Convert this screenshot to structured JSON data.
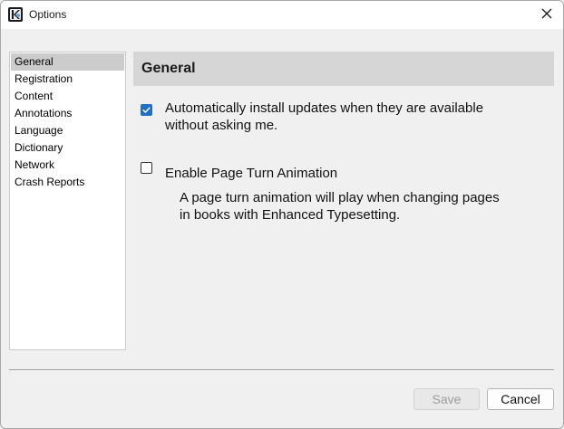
{
  "window": {
    "title": "Options",
    "icon": "kindle-reader-icon"
  },
  "sidebar": {
    "selected_index": 0,
    "items": [
      {
        "label": "General"
      },
      {
        "label": "Registration"
      },
      {
        "label": "Content"
      },
      {
        "label": "Annotations"
      },
      {
        "label": "Language"
      },
      {
        "label": "Dictionary"
      },
      {
        "label": "Network"
      },
      {
        "label": "Crash Reports"
      }
    ]
  },
  "main": {
    "section_title": "General",
    "options": [
      {
        "checked": true,
        "label_line1": "Automatically install updates when they are available",
        "label_line2": "without asking me."
      },
      {
        "checked": false,
        "label_line1": "Enable Page Turn Animation",
        "desc_line1": "A page turn animation will play when changing pages",
        "desc_line2": "in books with Enhanced Typesetting."
      }
    ]
  },
  "footer": {
    "save_label": "Save",
    "save_enabled": false,
    "cancel_label": "Cancel"
  },
  "colors": {
    "checkbox_accent": "#1f6fc5",
    "selected_nav": "#cccccc",
    "header_bar": "#d6d6d6"
  }
}
